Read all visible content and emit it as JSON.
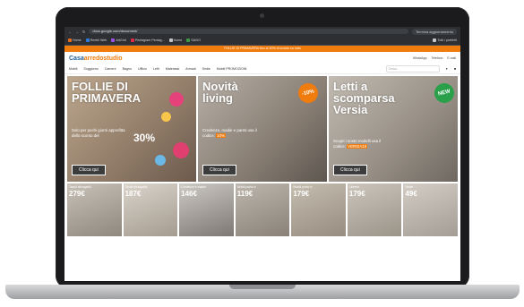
{
  "browser": {
    "url": "docs.google.com/document/",
    "update_button": "Termina aggiornamento",
    "bookmarks": [
      {
        "label": "Home",
        "color": "#e06c1c"
      },
      {
        "label": "Rentrii Web",
        "color": "#2b7bd9"
      },
      {
        "label": "ArtGrid",
        "color": "#9b51e0"
      },
      {
        "label": "Pentagram Pentag...",
        "color": "#e0294a"
      },
      {
        "label": "Home",
        "color": "#c6c6c6"
      },
      {
        "label": "SAVIO",
        "color": "#3e9b45"
      },
      {
        "label": "Tutti i preferiti",
        "color": "#c6c6c6"
      }
    ]
  },
  "site": {
    "promo_text": "FOLLIE DI PRIMAVERA fino al 30% di sconto su tutto",
    "logo": {
      "main": "Casa",
      "accent": "arredostudio"
    },
    "contacts": [
      "WhatsApp",
      "Telefono",
      "E-mail"
    ],
    "nav": [
      "Mobili",
      "Soggiorno",
      "Camere",
      "Bagno",
      "Ufficio",
      "Letti",
      "Materassi",
      "Armadi",
      "Sedie",
      "Mobili PROMOZIONI"
    ],
    "search_placeholder": "Cerca..."
  },
  "banners": [
    {
      "title_line1": "FOLLIE DI",
      "title_line2": "PRIMAVERA",
      "subtitle": "Solo per pochi giorni approfitta dello sconto del",
      "highlight": "30%",
      "cta": "Clicca qui"
    },
    {
      "title_line1": "Novità",
      "title_line2": "living",
      "subtitle": "Credenze, madie e pareti usa il codice:",
      "highlight": "10%",
      "badge": "-10%",
      "cta": "Clicca qui"
    },
    {
      "title_line1": "Letti a",
      "title_line2": "scomparsa",
      "title_line3": "Versia",
      "subtitle": "Scopri i nostri modelli usa il codice:",
      "highlight": "VERSIA10",
      "badge": "NEW",
      "cta": "Clicca qui"
    }
  ],
  "categories": [
    {
      "name": "Tavoli allungabili",
      "price": "279€"
    },
    {
      "name": "Tavoli allungabili",
      "price": "187€"
    },
    {
      "name": "Credenze e madie",
      "price": "146€"
    },
    {
      "name": "Mobili porta tv",
      "price": "119€"
    },
    {
      "name": "Mobili porta tv",
      "price": "179€"
    },
    {
      "name": "Librerie",
      "price": "179€"
    },
    {
      "name": "Sedie",
      "price": "49€"
    }
  ]
}
